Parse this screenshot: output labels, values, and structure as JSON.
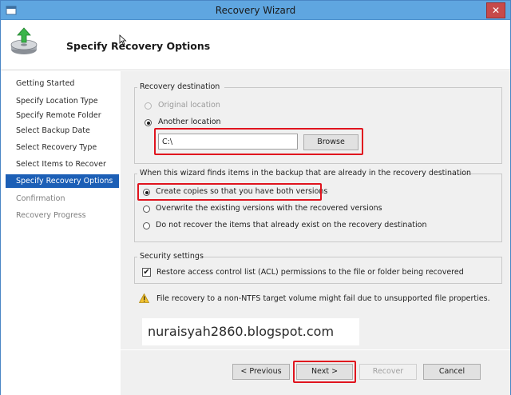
{
  "window": {
    "title": "Recovery Wizard",
    "close_glyph": "✕",
    "title_icon": "wizard-app-icon",
    "accent": "#5fa6e0"
  },
  "header": {
    "title": "Specify Recovery Options",
    "icon": "recovery-disk-arrow-icon"
  },
  "nav": {
    "items": [
      {
        "label": "Getting Started",
        "state": "normal"
      },
      {
        "label": "Specify Location Type",
        "state": "normal"
      },
      {
        "label": "Specify Remote Folder",
        "state": "normal"
      },
      {
        "label": "Select Backup Date",
        "state": "normal"
      },
      {
        "label": "Select Recovery Type",
        "state": "normal"
      },
      {
        "label": "Select Items to Recover",
        "state": "normal"
      },
      {
        "label": "Specify Recovery Options",
        "state": "active"
      },
      {
        "label": "Confirmation",
        "state": "disabled"
      },
      {
        "label": "Recovery Progress",
        "state": "disabled"
      }
    ],
    "active_color": "#1c5fb6"
  },
  "destination": {
    "group_label": "Recovery destination",
    "original_location": {
      "label": "Original location",
      "checked": false,
      "enabled": false
    },
    "another_location": {
      "label": "Another location",
      "checked": true,
      "enabled": true
    },
    "path_value": "C:\\",
    "browse_label": "Browse"
  },
  "conflicts": {
    "group_label": "When this wizard finds items in the backup that are already in the recovery destination",
    "options": [
      {
        "label": "Create copies so that you have both versions",
        "checked": true
      },
      {
        "label": "Overwrite the existing versions with the recovered versions",
        "checked": false
      },
      {
        "label": "Do not recover the items that already exist on the recovery destination",
        "checked": false
      }
    ]
  },
  "security": {
    "group_label": "Security settings",
    "restore_acl": {
      "label": "Restore access control list (ACL) permissions to the file or folder being recovered",
      "checked": true
    },
    "check_glyph": "✔"
  },
  "warning": {
    "icon": "warning-triangle-icon",
    "text": "File recovery to a non-NTFS target volume might fail due to unsupported file properties."
  },
  "watermark": {
    "text": "nuraisyah2860.blogspot.com"
  },
  "footer": {
    "previous_label": "< Previous",
    "next_label": "Next >",
    "recover_label": "Recover",
    "cancel_label": "Cancel"
  },
  "highlight_color": "#e0141e"
}
